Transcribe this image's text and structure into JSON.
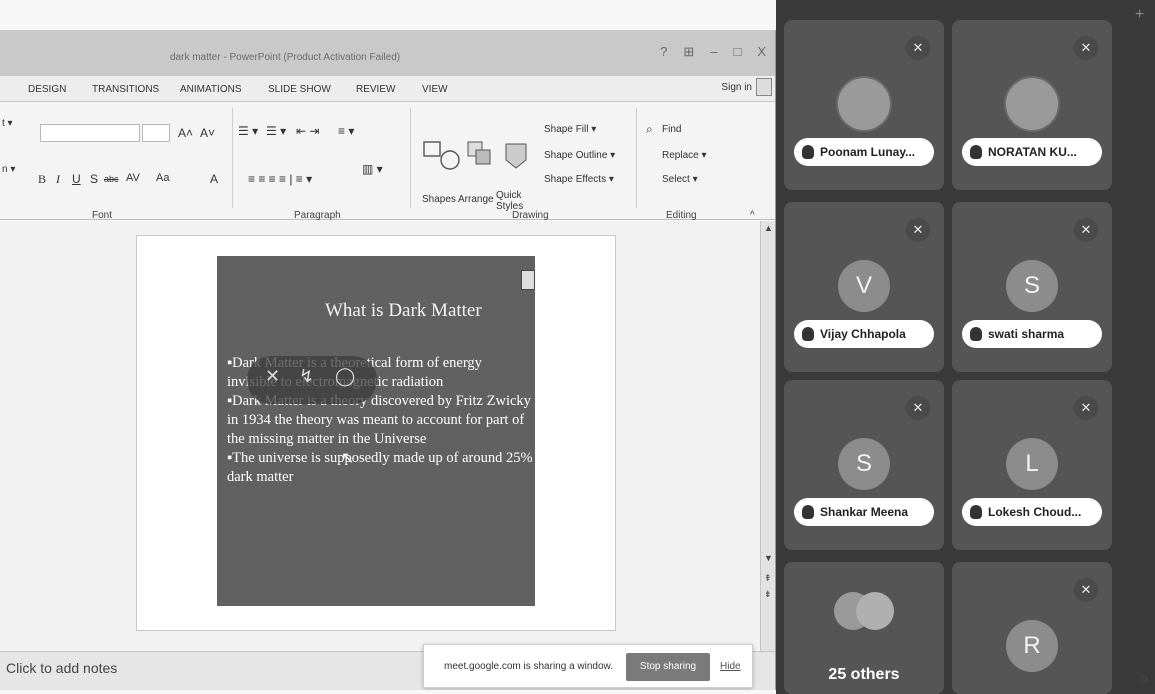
{
  "ppt": {
    "window_title": "dark matter - PowerPoint (Product Activation Failed)",
    "window_controls": [
      "?",
      "⊞",
      "–",
      "□",
      "X"
    ],
    "tabs": [
      "DESIGN",
      "TRANSITIONS",
      "ANIMATIONS",
      "SLIDE SHOW",
      "REVIEW",
      "VIEW"
    ],
    "sign_in": "Sign in",
    "ribbon": {
      "font_group": "Font",
      "paragraph_group": "Paragraph",
      "drawing_group": "Drawing",
      "editing_group": "Editing",
      "left_fragments": [
        "t ▾",
        "n ▾"
      ],
      "format_buttons": [
        "B",
        "I",
        "U",
        "S",
        "abc",
        "AV",
        "Aa",
        "A"
      ],
      "shapes": "Shapes",
      "arrange": "Arrange",
      "quick_styles": "Quick Styles",
      "shape_fill": "Shape Fill ▾",
      "shape_outline": "Shape Outline ▾",
      "shape_effects": "Shape Effects ▾",
      "find": "Find",
      "replace": "Replace ▾",
      "select": "Select ▾"
    },
    "slide": {
      "title": "What is Dark Matter",
      "bullets": [
        "Dark Matter is a theoretical form of energy invisible to electromagnetic radiation",
        "Dark Matter is a theory discovered by Fritz Zwicky in 1934 the theory was meant to account for part of the missing matter in the Universe",
        "The universe is supposedly made up of around 25% dark matter"
      ]
    },
    "notes_placeholder": "Click to add notes"
  },
  "share_banner": {
    "message": "meet.google.com is sharing a window.",
    "stop_label": "Stop sharing",
    "hide_label": "Hide"
  },
  "meet": {
    "participants": [
      {
        "name": "Poonam Lunay...",
        "initial": "",
        "photo": true
      },
      {
        "name": "NORATAN KU...",
        "initial": "",
        "photo": true
      },
      {
        "name": "Vijay Chhapola",
        "initial": "V",
        "photo": false
      },
      {
        "name": "swati sharma",
        "initial": "S",
        "photo": false
      },
      {
        "name": "Shankar Meena",
        "initial": "S",
        "photo": false
      },
      {
        "name": "Lokesh Choud...",
        "initial": "L",
        "photo": false
      }
    ],
    "others_label": "25 others",
    "last_initial": "R"
  }
}
